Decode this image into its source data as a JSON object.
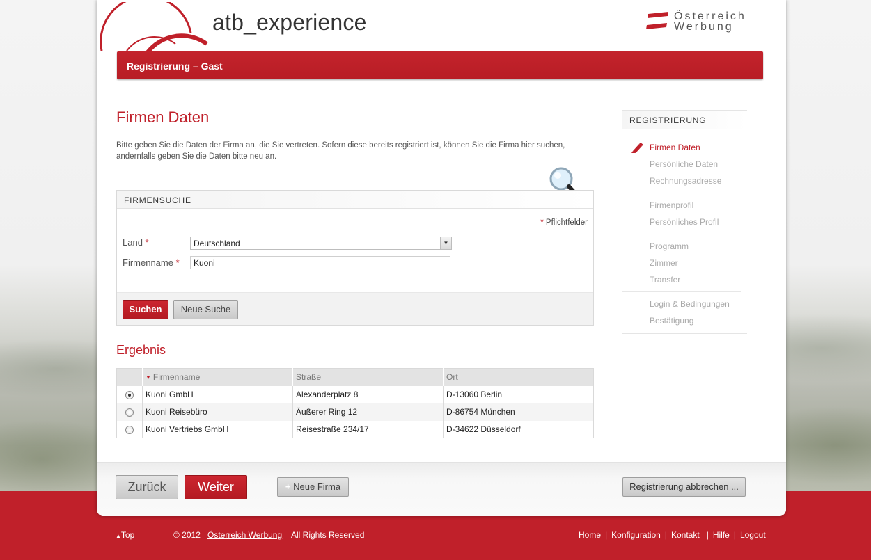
{
  "brand": {
    "name": "atb_experience",
    "partner_line1": "Österreich",
    "partner_line2": "Werbung"
  },
  "colors": {
    "accent": "#c0202a",
    "muted_text": "#aaaaaa"
  },
  "header": {
    "title": "Registrierung – Gast"
  },
  "main": {
    "heading": "Firmen Daten",
    "intro": "Bitte geben Sie die Daten der Firma an, die Sie vertreten. Sofern diese bereits registriert ist, können Sie die Firma hier suchen, andernfalls geben Sie die Daten bitte neu an."
  },
  "search": {
    "title": "FIRMENSUCHE",
    "required_note": "Pflichtfelder",
    "required_mark": "*",
    "country_label": "Land",
    "country_value": "Deutschland",
    "company_label": "Firmenname",
    "company_value": "Kuoni",
    "search_button": "Suchen",
    "new_search_button": "Neue Suche"
  },
  "results": {
    "heading": "Ergebnis",
    "columns": [
      "Firmenname",
      "Straße",
      "Ort"
    ],
    "rows": [
      {
        "selected": true,
        "name": "Kuoni GmbH",
        "street": "Alexanderplatz 8",
        "city": "D-13060 Berlin"
      },
      {
        "selected": false,
        "name": "Kuoni Reisebüro",
        "street": "Äußerer Ring 12",
        "city": "D-86754 München"
      },
      {
        "selected": false,
        "name": "Kuoni Vertriebs GmbH",
        "street": "Reisestraße 234/17",
        "city": "D-34622 Düsseldorf"
      }
    ]
  },
  "sidebar": {
    "title": "REGISTRIERUNG",
    "groups": [
      [
        "Firmen Daten",
        "Persönliche Daten",
        "Rechnungsadresse"
      ],
      [
        "Firmenprofil",
        "Persönliches Profil"
      ],
      [
        "Programm",
        "Zimmer",
        "Transfer"
      ],
      [
        "Login & Bedingungen",
        "Bestätigung"
      ]
    ]
  },
  "actions": {
    "back": "Zurück",
    "next": "Weiter",
    "new_company": "Neue Firma",
    "cancel": "Registrierung abbrechen ..."
  },
  "footer": {
    "top": "Top",
    "copyright": "© 2012",
    "company_link": "Österreich Werbung",
    "rights": "All Rights Reserved",
    "links": [
      "Home",
      "Konfiguration",
      "Kontakt",
      "Hilfe",
      "Logout"
    ]
  }
}
